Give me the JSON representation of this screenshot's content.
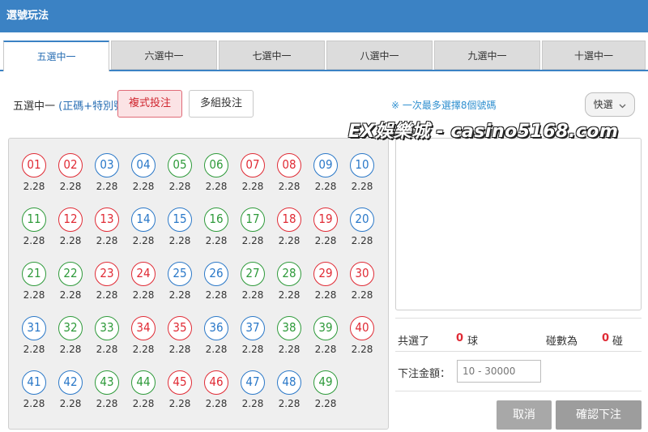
{
  "window": {
    "title": "選號玩法"
  },
  "tabs": [
    {
      "label": "五選中一",
      "active": true
    },
    {
      "label": "六選中一",
      "active": false
    },
    {
      "label": "七選中一",
      "active": false
    },
    {
      "label": "八選中一",
      "active": false
    },
    {
      "label": "九選中一",
      "active": false
    },
    {
      "label": "十選中一",
      "active": false
    }
  ],
  "mode": {
    "label": "五選中一",
    "sub": "(正碼+特別號)",
    "colon": "："
  },
  "buttons": {
    "complex": "複式投注",
    "multi": "多組投注",
    "quick": "快選",
    "cancel": "取消",
    "confirm": "確認下注"
  },
  "hint": "※ 一次最多選擇8個號碼",
  "watermark": "EX娛樂城 - casino5168.com",
  "balls": [
    {
      "n": "01",
      "c": "red"
    },
    {
      "n": "02",
      "c": "red"
    },
    {
      "n": "03",
      "c": "blue"
    },
    {
      "n": "04",
      "c": "blue"
    },
    {
      "n": "05",
      "c": "green"
    },
    {
      "n": "06",
      "c": "green"
    },
    {
      "n": "07",
      "c": "red"
    },
    {
      "n": "08",
      "c": "red"
    },
    {
      "n": "09",
      "c": "blue"
    },
    {
      "n": "10",
      "c": "blue"
    },
    {
      "n": "11",
      "c": "green"
    },
    {
      "n": "12",
      "c": "red"
    },
    {
      "n": "13",
      "c": "red"
    },
    {
      "n": "14",
      "c": "blue"
    },
    {
      "n": "15",
      "c": "blue"
    },
    {
      "n": "16",
      "c": "green"
    },
    {
      "n": "17",
      "c": "green"
    },
    {
      "n": "18",
      "c": "red"
    },
    {
      "n": "19",
      "c": "red"
    },
    {
      "n": "20",
      "c": "blue"
    },
    {
      "n": "21",
      "c": "green"
    },
    {
      "n": "22",
      "c": "green"
    },
    {
      "n": "23",
      "c": "red"
    },
    {
      "n": "24",
      "c": "red"
    },
    {
      "n": "25",
      "c": "blue"
    },
    {
      "n": "26",
      "c": "blue"
    },
    {
      "n": "27",
      "c": "green"
    },
    {
      "n": "28",
      "c": "green"
    },
    {
      "n": "29",
      "c": "red"
    },
    {
      "n": "30",
      "c": "red"
    },
    {
      "n": "31",
      "c": "blue"
    },
    {
      "n": "32",
      "c": "green"
    },
    {
      "n": "33",
      "c": "green"
    },
    {
      "n": "34",
      "c": "red"
    },
    {
      "n": "35",
      "c": "red"
    },
    {
      "n": "36",
      "c": "blue"
    },
    {
      "n": "37",
      "c": "blue"
    },
    {
      "n": "38",
      "c": "green"
    },
    {
      "n": "39",
      "c": "green"
    },
    {
      "n": "40",
      "c": "red"
    },
    {
      "n": "41",
      "c": "blue"
    },
    {
      "n": "42",
      "c": "blue"
    },
    {
      "n": "43",
      "c": "green"
    },
    {
      "n": "44",
      "c": "green"
    },
    {
      "n": "45",
      "c": "red"
    },
    {
      "n": "46",
      "c": "red"
    },
    {
      "n": "47",
      "c": "blue"
    },
    {
      "n": "48",
      "c": "blue"
    },
    {
      "n": "49",
      "c": "green"
    }
  ],
  "odds": "2.28",
  "summary": {
    "selected_label": "共選了",
    "selected_count": "0",
    "selected_unit": "球",
    "combos_label": "碰數為",
    "combos_count": "0",
    "combos_unit": "碰"
  },
  "amount": {
    "label": "下注金額：",
    "placeholder": "10 - 30000"
  },
  "colors": {
    "header": "#3b82c4",
    "red": "#e02b35",
    "blue": "#2a78c8",
    "green": "#2e9a3a"
  },
  "icons": {
    "quick_dropdown": "chevron-down-icon"
  }
}
